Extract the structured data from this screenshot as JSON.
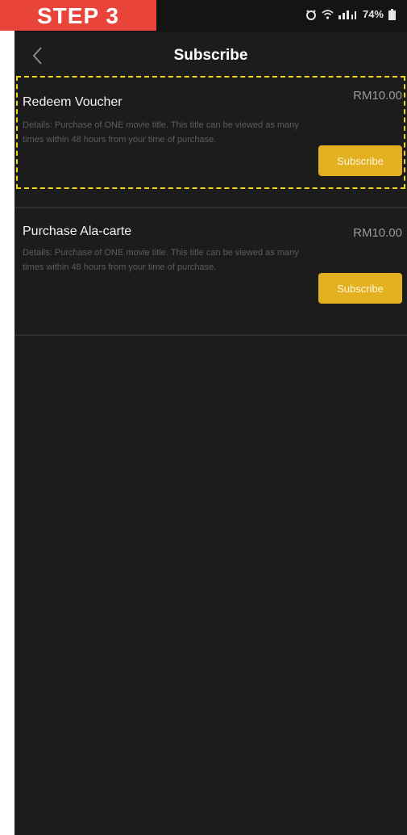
{
  "banner": {
    "label": "STEP 3"
  },
  "status_bar": {
    "battery": "74%"
  },
  "header": {
    "title": "Subscribe"
  },
  "options": [
    {
      "title": "Redeem Voucher",
      "price": "RM10.00",
      "details": "Details: Purchase of ONE movie title. This title can be viewed as many times within 48 hours from your time of purchase.",
      "button": "Subscribe"
    },
    {
      "title": "Purchase Ala-carte",
      "price": "RM10.00",
      "details": "Details: Purchase of ONE movie title. This title can be viewed as many times within 48 hours from your time of purchase.",
      "button": "Subscribe"
    }
  ],
  "colors": {
    "accent": "#e3b020",
    "highlight": "#f2d417",
    "banner": "#e8443a",
    "background": "#1c1c1c"
  },
  "icons": [
    "back-chevron-icon",
    "alarm-icon",
    "wifi-icon",
    "signal-icon",
    "battery-icon"
  ]
}
